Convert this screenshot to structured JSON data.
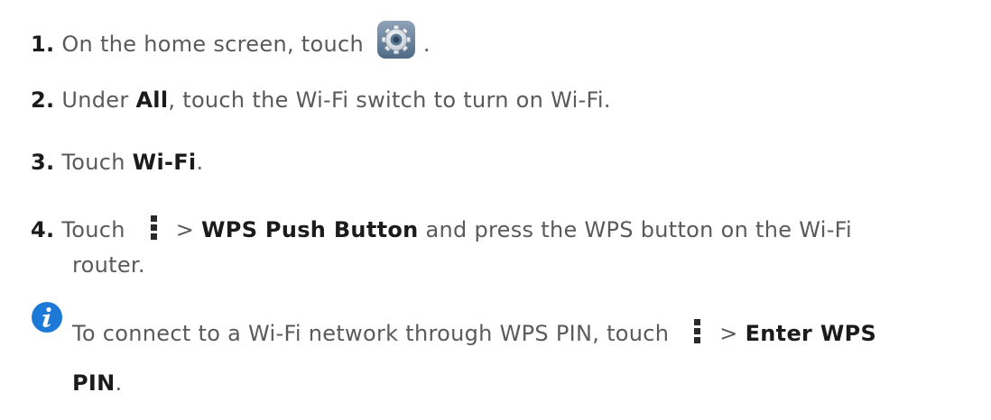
{
  "steps": [
    {
      "num": "1.",
      "text_a": "On the home screen, touch",
      "text_b": "."
    },
    {
      "num": "2.",
      "text_a": "Under ",
      "bold": "All",
      "text_b": ", touch the Wi-Fi switch to turn on Wi-Fi."
    },
    {
      "num": "3.",
      "text_a": "Touch ",
      "bold": "Wi-Fi",
      "text_b": "."
    },
    {
      "num": "4.",
      "text_a": "Touch",
      "sep": "> ",
      "bold": "WPS Push Button",
      "text_b": " and press the WPS button on the Wi-Fi",
      "text_c": "router."
    }
  ],
  "note": {
    "text_a": "To connect to a Wi-Fi network through WPS PIN, touch",
    "sep": "> ",
    "bold_a": "Enter WPS",
    "bold_b": "PIN",
    "text_b": "."
  },
  "icons": {
    "settings": "settings-gear-icon",
    "menu": "more-vertical-icon",
    "info": "info-icon"
  },
  "colors": {
    "text": "#5a5a5a",
    "emphasis": "#1b1b1b",
    "info_blue": "#1c7ad6"
  }
}
